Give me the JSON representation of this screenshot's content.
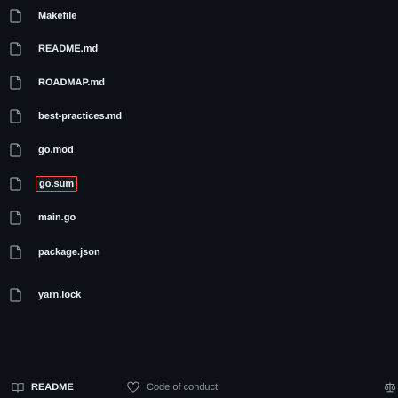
{
  "files": [
    {
      "name": "Makefile",
      "icon": "file-icon"
    },
    {
      "name": "README.md",
      "icon": "file-icon"
    },
    {
      "name": "ROADMAP.md",
      "icon": "file-icon"
    },
    {
      "name": "best-practices.md",
      "icon": "file-icon"
    },
    {
      "name": "go.mod",
      "icon": "file-icon"
    },
    {
      "name": "go.sum",
      "icon": "file-icon",
      "highlighted": true
    },
    {
      "name": "main.go",
      "icon": "file-icon"
    },
    {
      "name": "package.json",
      "icon": "file-icon"
    },
    {
      "name": "yarn.lock",
      "icon": "file-icon"
    }
  ],
  "bottom_tabs": [
    {
      "label": "README",
      "icon": "book-icon",
      "active": true
    },
    {
      "label": "Code of conduct",
      "icon": "heart-icon",
      "active": false
    },
    {
      "label": "",
      "icon": "law-icon",
      "active": false
    }
  ],
  "colors": {
    "background": "#0d1117",
    "text": "#e6edf3",
    "muted": "#9198a1",
    "highlight_border": "#f85149"
  }
}
